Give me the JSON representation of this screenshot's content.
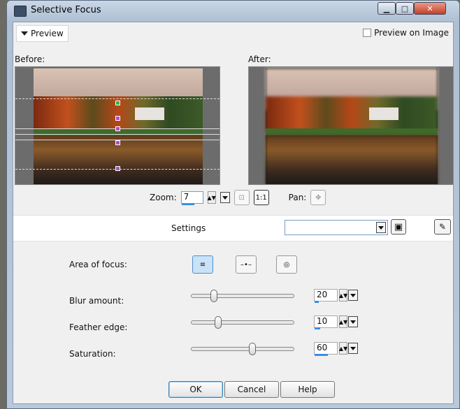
{
  "window": {
    "title": "Selective Focus"
  },
  "preview": {
    "toggle_label": "Preview",
    "preview_on_image_label": "Preview on Image",
    "preview_on_image_checked": false,
    "before_label": "Before:",
    "after_label": "After:",
    "zoom_label": "Zoom:",
    "zoom_value": "7",
    "zoom_fill_percent": 60,
    "pan_label": "Pan:"
  },
  "settings": {
    "label": "Settings",
    "selected_value": ""
  },
  "controls": {
    "area_of_focus_label": "Area of focus:",
    "area_of_focus_selected": 0,
    "blur": {
      "label": "Blur amount:",
      "value": "20",
      "fraction": 0.2
    },
    "feather": {
      "label": "Feather edge:",
      "value": "10",
      "fraction": 0.24
    },
    "saturation": {
      "label": "Saturation:",
      "value": "60",
      "fraction": 0.6
    }
  },
  "buttons": {
    "ok": "OK",
    "cancel": "Cancel",
    "help": "Help"
  },
  "icons": {
    "app": "selective-focus-icon",
    "reset_zoom": "fit-icon",
    "one_to_one": "one-to-one-icon",
    "pan": "pan-icon",
    "save": "save-icon",
    "preset_manager": "preset-manager-icon"
  }
}
